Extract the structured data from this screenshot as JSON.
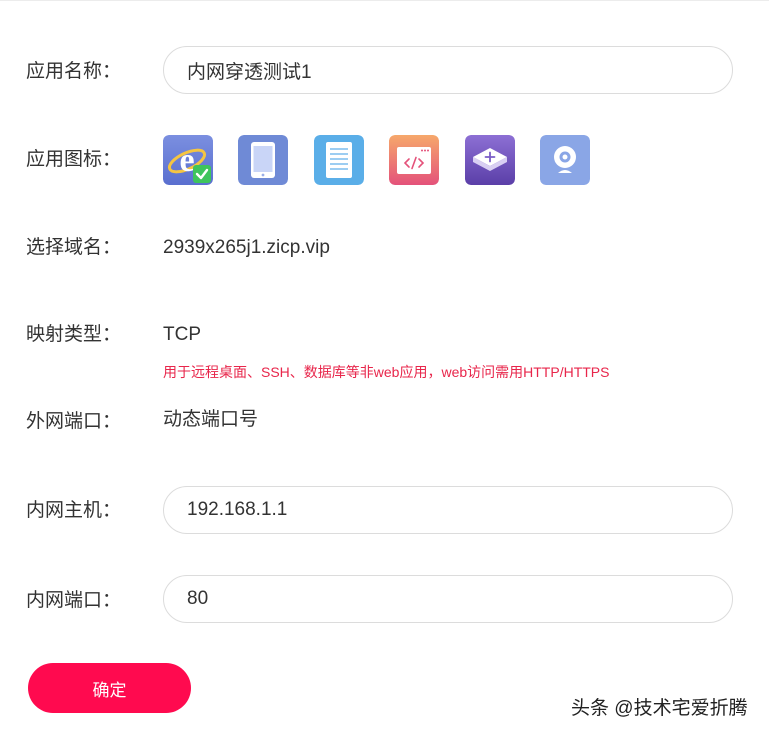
{
  "form": {
    "app_name": {
      "label": "应用名称：",
      "value": "内网穿透测试1"
    },
    "app_icon": {
      "label": "应用图标：",
      "icons": [
        {
          "name": "ie-browser-icon",
          "selected": true
        },
        {
          "name": "tablet-icon",
          "selected": false
        },
        {
          "name": "document-list-icon",
          "selected": false
        },
        {
          "name": "code-window-icon",
          "selected": false
        },
        {
          "name": "network-switch-icon",
          "selected": false
        },
        {
          "name": "webcam-icon",
          "selected": false
        }
      ]
    },
    "domain": {
      "label": "选择域名：",
      "value": "2939x265j1.zicp.vip"
    },
    "mapping_type": {
      "label": "映射类型：",
      "value": "TCP",
      "hint": "用于远程桌面、SSH、数据库等非web应用，web访问需用HTTP/HTTPS"
    },
    "external_port": {
      "label": "外网端口：",
      "value": "动态端口号"
    },
    "internal_host": {
      "label": "内网主机：",
      "value": "192.168.1.1"
    },
    "internal_port": {
      "label": "内网端口：",
      "value": "80"
    },
    "confirm_label": "确定"
  },
  "watermark": "头条 @技术宅爱折腾",
  "colors": {
    "accent": "#ff0a4f",
    "hint": "#e8264b",
    "label": "#333333",
    "input_border": "#dcdcdc"
  }
}
